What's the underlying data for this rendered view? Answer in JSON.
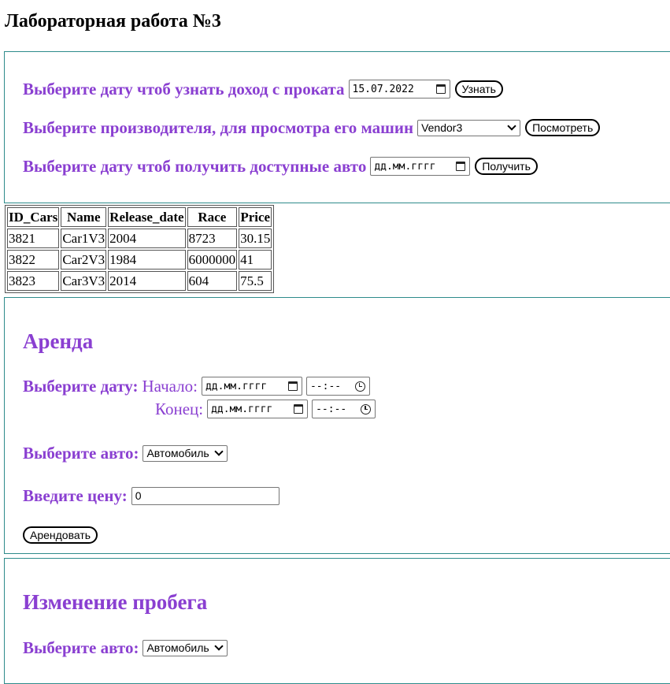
{
  "page": {
    "title": "Лабораторная работа №3"
  },
  "income": {
    "label": "Выберите дату чтоб узнать доход с проката",
    "date_value": "15.07.2022",
    "button": "Узнать"
  },
  "vendor": {
    "label": "Выберите производителя, для просмотра его машин",
    "selected": "Vendor3",
    "button": "Посмотреть"
  },
  "available": {
    "label": "Выберите дату чтоб получить доступные авто",
    "date_placeholder": "дд.мм.гггг",
    "button": "Получить"
  },
  "table": {
    "headers": [
      "ID_Cars",
      "Name",
      "Release_date",
      "Race",
      "Price"
    ],
    "rows": [
      [
        "3821",
        "Car1V3",
        "2004",
        "8723",
        "30.15"
      ],
      [
        "3822",
        "Car2V3",
        "1984",
        "6000000",
        "41"
      ],
      [
        "3823",
        "Car3V3",
        "2014",
        "604",
        "75.5"
      ]
    ]
  },
  "rent": {
    "title": "Аренда",
    "date_label": "Выберите дату:",
    "start_label": "Начало:",
    "end_label": "Конец:",
    "date_placeholder": "дд.мм.гггг",
    "time_placeholder": "--:--",
    "car_label": "Выберите авто:",
    "car_selected": "Автомобиль",
    "price_label": "Введите цену:",
    "price_value": "0",
    "button": "Арендовать"
  },
  "mileage": {
    "title": "Изменение пробега",
    "car_label": "Выберите авто:",
    "car_selected": "Автомобиль"
  }
}
